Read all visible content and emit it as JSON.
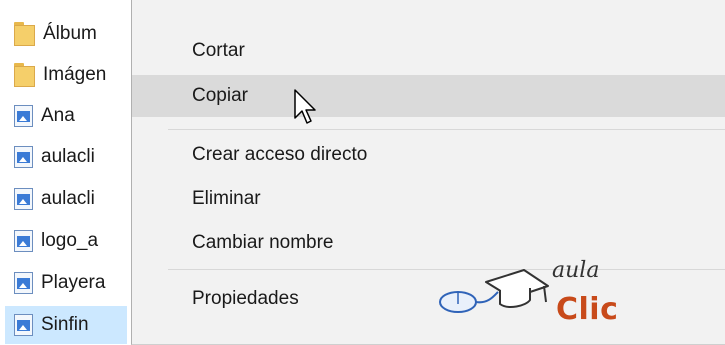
{
  "files": [
    {
      "name": "Álbum",
      "icon": "folder-icon"
    },
    {
      "name": "Imágen",
      "icon": "folder-icon"
    },
    {
      "name": "Ana",
      "icon": "image-file-icon"
    },
    {
      "name": "aulacli",
      "icon": "image-file-icon"
    },
    {
      "name": "aulacli",
      "icon": "image-file-icon"
    },
    {
      "name": "logo_a",
      "icon": "image-file-icon"
    },
    {
      "name": "Playera",
      "icon": "image-file-icon"
    },
    {
      "name": "Sinfin",
      "icon": "image-file-icon",
      "selected": true
    }
  ],
  "menu": {
    "cut": "Cortar",
    "copy": "Copiar",
    "create_shortcut": "Crear acceso directo",
    "delete": "Eliminar",
    "rename": "Cambiar nombre",
    "properties": "Propiedades",
    "hovered": "copy"
  },
  "logo": {
    "line1": "aula",
    "line2": "Clic"
  },
  "colors": {
    "selection": "#cce8ff",
    "menu_bg": "#f2f2f2",
    "hover": "#dadada",
    "brand": "#c84a1a"
  }
}
